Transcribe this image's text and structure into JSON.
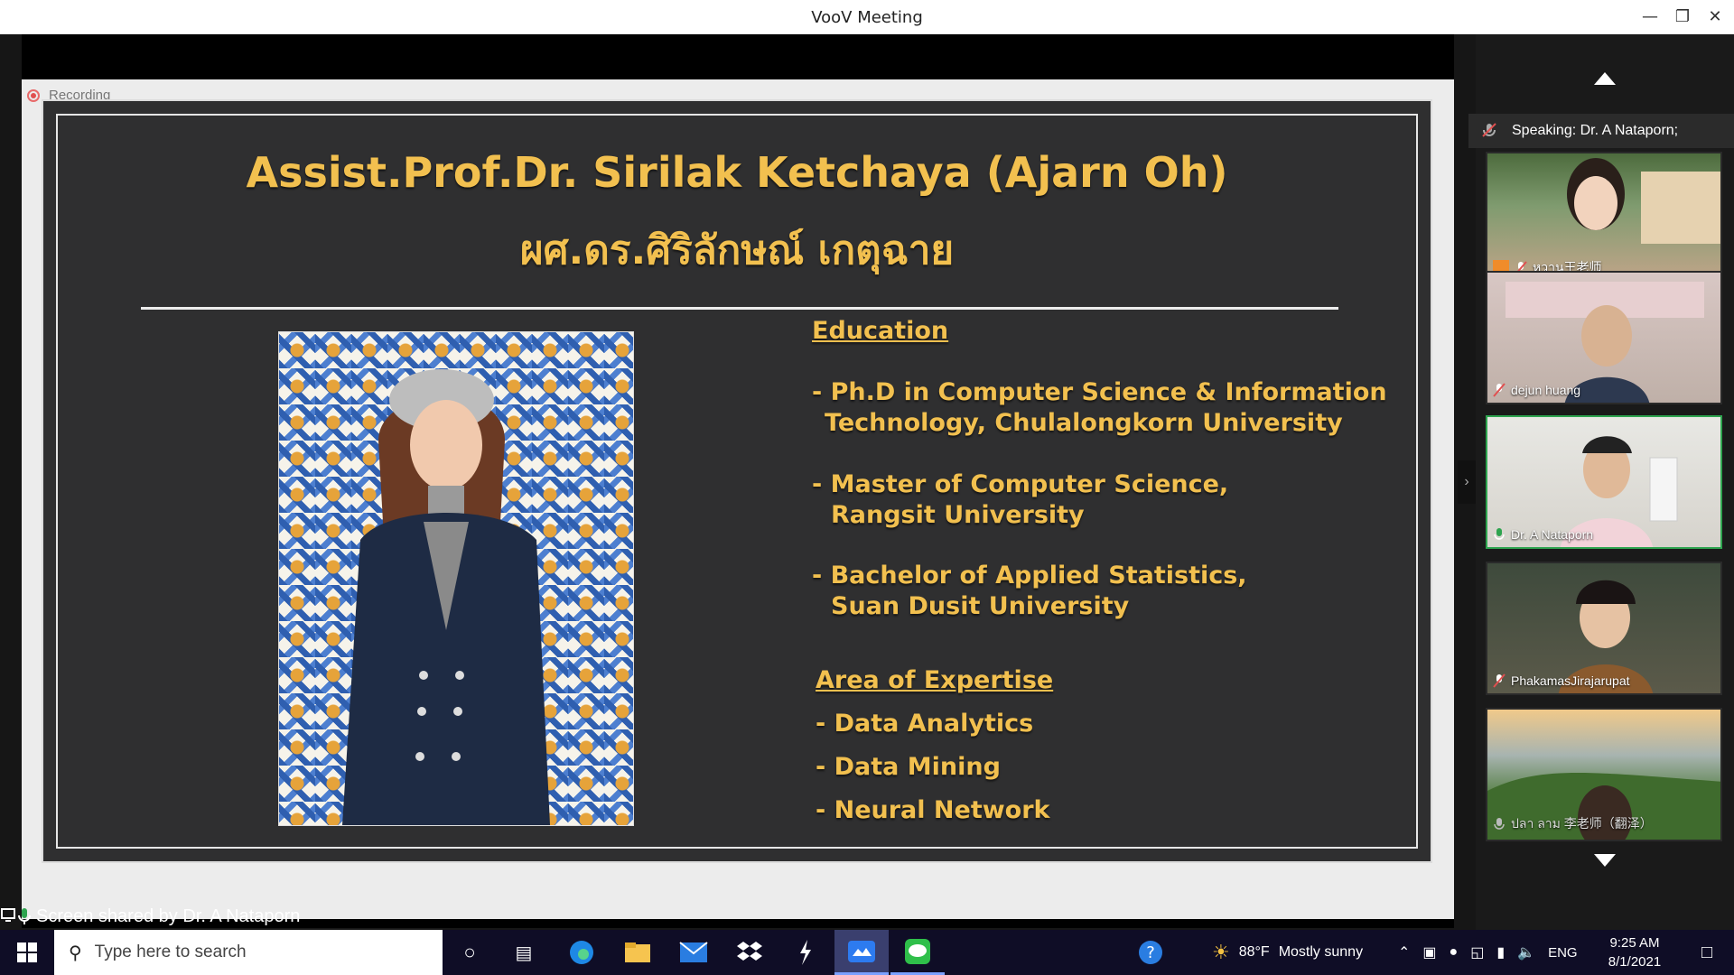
{
  "window": {
    "title": "VooV Meeting"
  },
  "recording": {
    "label": "Recording"
  },
  "slide": {
    "title_en": "Assist.Prof.Dr. Sirilak Ketchaya (Ajarn Oh)",
    "title_th": "ผศ.ดร.ศิริลักษณ์ เกตุฉาย",
    "education_heading": "Education",
    "education": [
      {
        "line1": "- Ph.D in Computer Science & Information",
        "line2": "Technology, Chulalongkorn University"
      },
      {
        "line1": "- Master of Computer Science,",
        "line2": "Rangsit University"
      },
      {
        "line1": "- Bachelor of Applied Statistics,",
        "line2": "Suan Dusit University"
      }
    ],
    "expertise_heading": "Area of Expertise",
    "expertise": [
      "- Data Analytics",
      "- Data Mining",
      "- Neural Network"
    ]
  },
  "share_bar": {
    "text": "Screen shared by Dr. A Nataporn"
  },
  "sidebar": {
    "speaking": "Speaking: Dr. A Nataporn;",
    "participants": [
      {
        "name": "หวาน王老师",
        "mic": "muted",
        "active": false,
        "host_badge": true
      },
      {
        "name": "dejun huang",
        "mic": "muted",
        "active": false,
        "host_badge": false
      },
      {
        "name": "Dr. A Nataporn",
        "mic": "on",
        "active": true,
        "host_badge": false
      },
      {
        "name": "PhakamasJirajarupat",
        "mic": "muted",
        "active": false,
        "host_badge": false
      },
      {
        "name": "ปลา ลาม 李老师（翻泽）",
        "mic": "off",
        "active": false,
        "host_badge": false
      }
    ]
  },
  "taskbar": {
    "search_placeholder": "Type here to search",
    "weather": {
      "temp": "88°F",
      "condition": "Mostly sunny"
    },
    "language": "ENG",
    "time": "9:25 AM",
    "date": "8/1/2021"
  },
  "colors": {
    "accent_gold": "#f2c04f",
    "active_tile": "#2ea44f",
    "slide_bg": "#2f2f30"
  }
}
